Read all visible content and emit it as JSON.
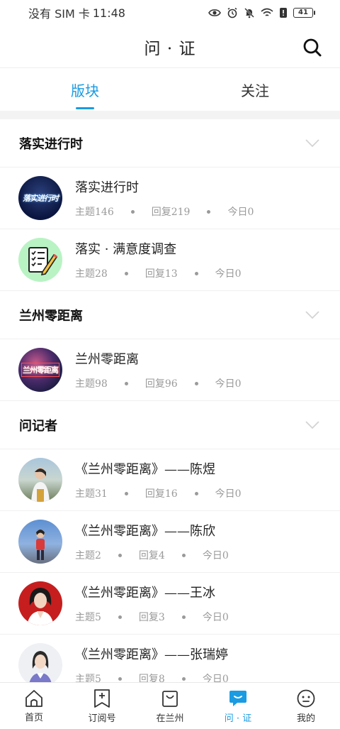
{
  "status_bar": {
    "carrier": "没有 SIM 卡",
    "time": "11:48",
    "battery": "41",
    "icons": [
      "eye-icon",
      "alarm-icon",
      "mute-icon",
      "wifi-icon",
      "alert-icon",
      "battery-icon"
    ]
  },
  "header": {
    "title": "问 · 证",
    "search_icon": "search-icon"
  },
  "tabs": [
    {
      "label": "版块",
      "active": true
    },
    {
      "label": "关注",
      "active": false
    }
  ],
  "sections": [
    {
      "title": "落实进行时",
      "items": [
        {
          "title": "落实进行时",
          "topics": "主题146",
          "replies": "回复219",
          "today": "今日0",
          "avatar_text": "落实进行时"
        },
        {
          "title": "落实 · 满意度调查",
          "topics": "主题28",
          "replies": "回复13",
          "today": "今日0"
        }
      ]
    },
    {
      "title": "兰州零距离",
      "items": [
        {
          "title": "兰州零距离",
          "topics": "主题98",
          "replies": "回复96",
          "today": "今日0",
          "avatar_text": "兰州零距离"
        }
      ]
    },
    {
      "title": "问记者",
      "items": [
        {
          "title": "《兰州零距离》——陈煜",
          "topics": "主题31",
          "replies": "回复16",
          "today": "今日0"
        },
        {
          "title": "《兰州零距离》——陈欣",
          "topics": "主题2",
          "replies": "回复4",
          "today": "今日0"
        },
        {
          "title": "《兰州零距离》——王冰",
          "topics": "主题5",
          "replies": "回复3",
          "today": "今日0"
        },
        {
          "title": "《兰州零距离》——张瑞婷",
          "topics": "主题5",
          "replies": "回复8",
          "today": "今日0"
        }
      ]
    }
  ],
  "bottom_nav": [
    {
      "label": "首页",
      "icon": "home-icon",
      "active": false
    },
    {
      "label": "订阅号",
      "icon": "subscribe-icon",
      "active": false
    },
    {
      "label": "在兰州",
      "icon": "bag-icon",
      "active": false
    },
    {
      "label": "问 · 证",
      "icon": "chat-icon",
      "active": true
    },
    {
      "label": "我的",
      "icon": "profile-icon",
      "active": false
    }
  ],
  "colors": {
    "accent": "#1a9be2",
    "muted": "#9a9a9a",
    "band": "#f3f3f3"
  }
}
